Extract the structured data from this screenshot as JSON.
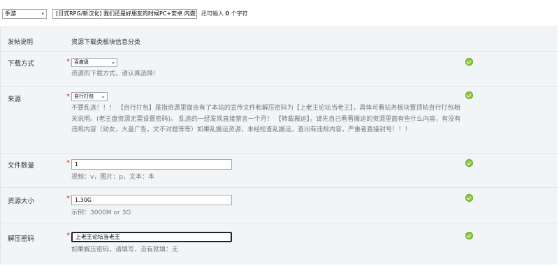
{
  "top": {
    "type_select": "手游",
    "title_value": "[日式RPG/新汉化] 我们还是好朋友的时候PC+安卓 内嵌汉化版",
    "remain_prefix": "还可输入",
    "remain_count": "0",
    "remain_suffix": "个字符"
  },
  "form": {
    "header_left": "发帖说明",
    "header_right": "资源下载类板块信息分类",
    "required_mark": "*",
    "download": {
      "label": "下载方式",
      "value": "百度盘",
      "hint": "资源的下载方式，请认真选择!"
    },
    "source": {
      "label": "来源",
      "value": "自行打包",
      "hint": "不要乱选！！！ 【自行打包】是指资源里面含有了本站的宣传文件和解压密码为【上老王论坛当老王】，具体可看站务板块置顶帖自行打包相关说明。(老王盘资源无需设置密码)。 乱选的一经发现直接禁言一个月！ 【转载搬运】，请先自己看看搬运的资源里面有些什么内容，有没有违规内容（幼女，大量广告，文不对题等等）如果乱搬运资源，未经检查乱搬运，查出有违规内容，严重者直接封号！！！"
    },
    "file_count": {
      "label": "文件数量",
      "value": "1",
      "hint": "视频：v，图片：p，文本：本"
    },
    "size": {
      "label": "资源大小",
      "value": "1.30G",
      "hint": "示例：3000M or 3G"
    },
    "password": {
      "label": "解压密码",
      "value": "上老王论坛当老王",
      "hint": "如果解压密码，请填写，没有就填：无"
    }
  },
  "icons": {
    "valid": "check-circle-icon",
    "valid_color": "#8dc63f"
  }
}
